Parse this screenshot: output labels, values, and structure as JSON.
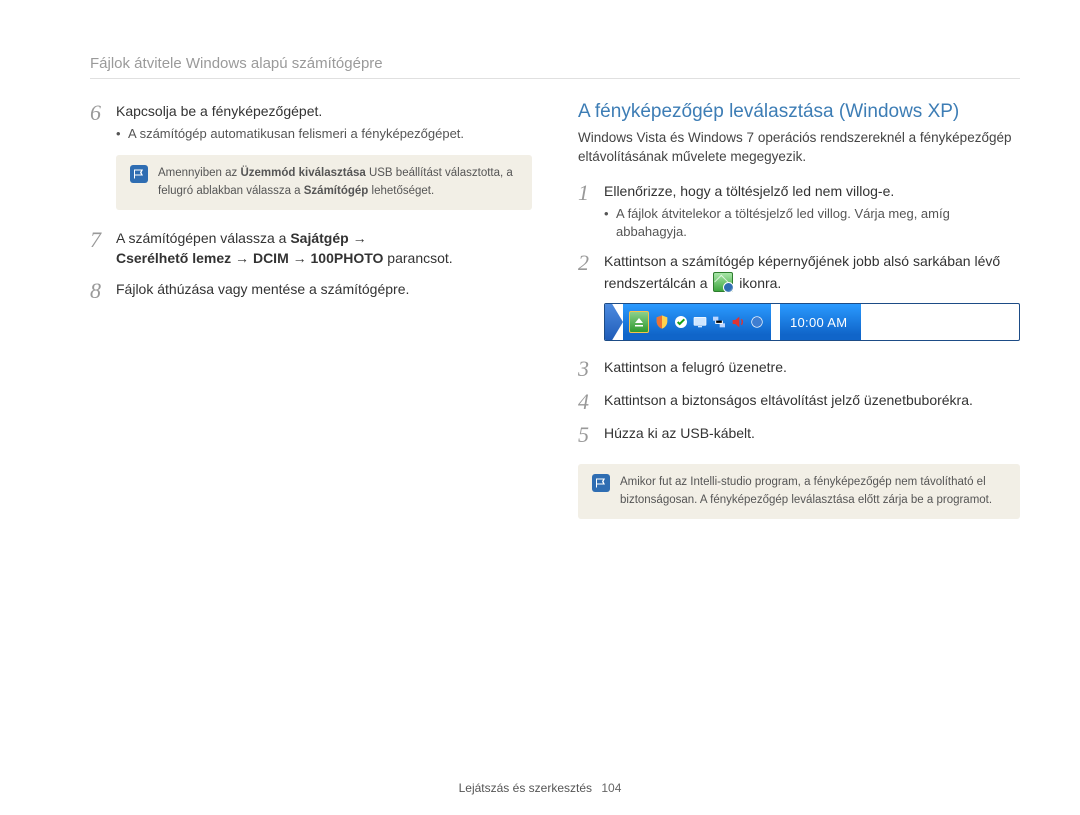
{
  "header": {
    "title": "Fájlok átvitele Windows alapú számítógépre"
  },
  "left": {
    "steps": {
      "6": {
        "text": "Kapcsolja be a fényképezőgépet.",
        "bullet": "A számítógép automatikusan felismeri a fényképezőgépet."
      },
      "7": {
        "pre": "A számítógépen válassza a ",
        "b1": "Sajátgép",
        "arrow1": " →",
        "b2": "Cserélhető lemez",
        "arrow2": " → ",
        "b3": "DCIM",
        "arrow3": " → ",
        "b4": "100PHOTO",
        "post": " parancsot."
      },
      "8": {
        "text": "Fájlok áthúzása vagy mentése a számítógépre."
      }
    },
    "note": {
      "pre": "Amennyiben az ",
      "b1": "Üzemmód kiválasztása",
      "mid": " USB beállítást választotta, a felugró ablakban válassza a ",
      "b2": "Számítógép",
      "post": " lehetőséget."
    }
  },
  "right": {
    "title": "A fényképezőgép leválasztása (Windows XP)",
    "intro": "Windows Vista és Windows 7 operációs rendszereknél a fényképezőgép eltávolításának művelete megegyezik.",
    "steps": {
      "1": {
        "text": "Ellenőrizze, hogy a töltésjelző led nem villog-e.",
        "bullet": "A fájlok átvitelekor a töltésjelző led villog. Várja meg, amíg abbahagyja."
      },
      "2": {
        "pre": "Kattintson a számítógép képernyőjének jobb alsó sarkában lévő rendszertálcán a ",
        "post": " ikonra."
      },
      "3": {
        "text": "Kattintson a felugró üzenetre."
      },
      "4": {
        "text": "Kattintson a biztonságos eltávolítást jelző üzenetbuborékra."
      },
      "5": {
        "text": "Húzza ki az USB-kábelt."
      }
    },
    "note": "Amikor fut az Intelli-studio program, a fényképezőgép nem távolítható el biztonságosan. A fényképezőgép leválasztása előtt zárja be a programot.",
    "clock": "10:00 AM"
  },
  "footer": {
    "label": "Lejátszás és szerkesztés",
    "page": "104"
  }
}
